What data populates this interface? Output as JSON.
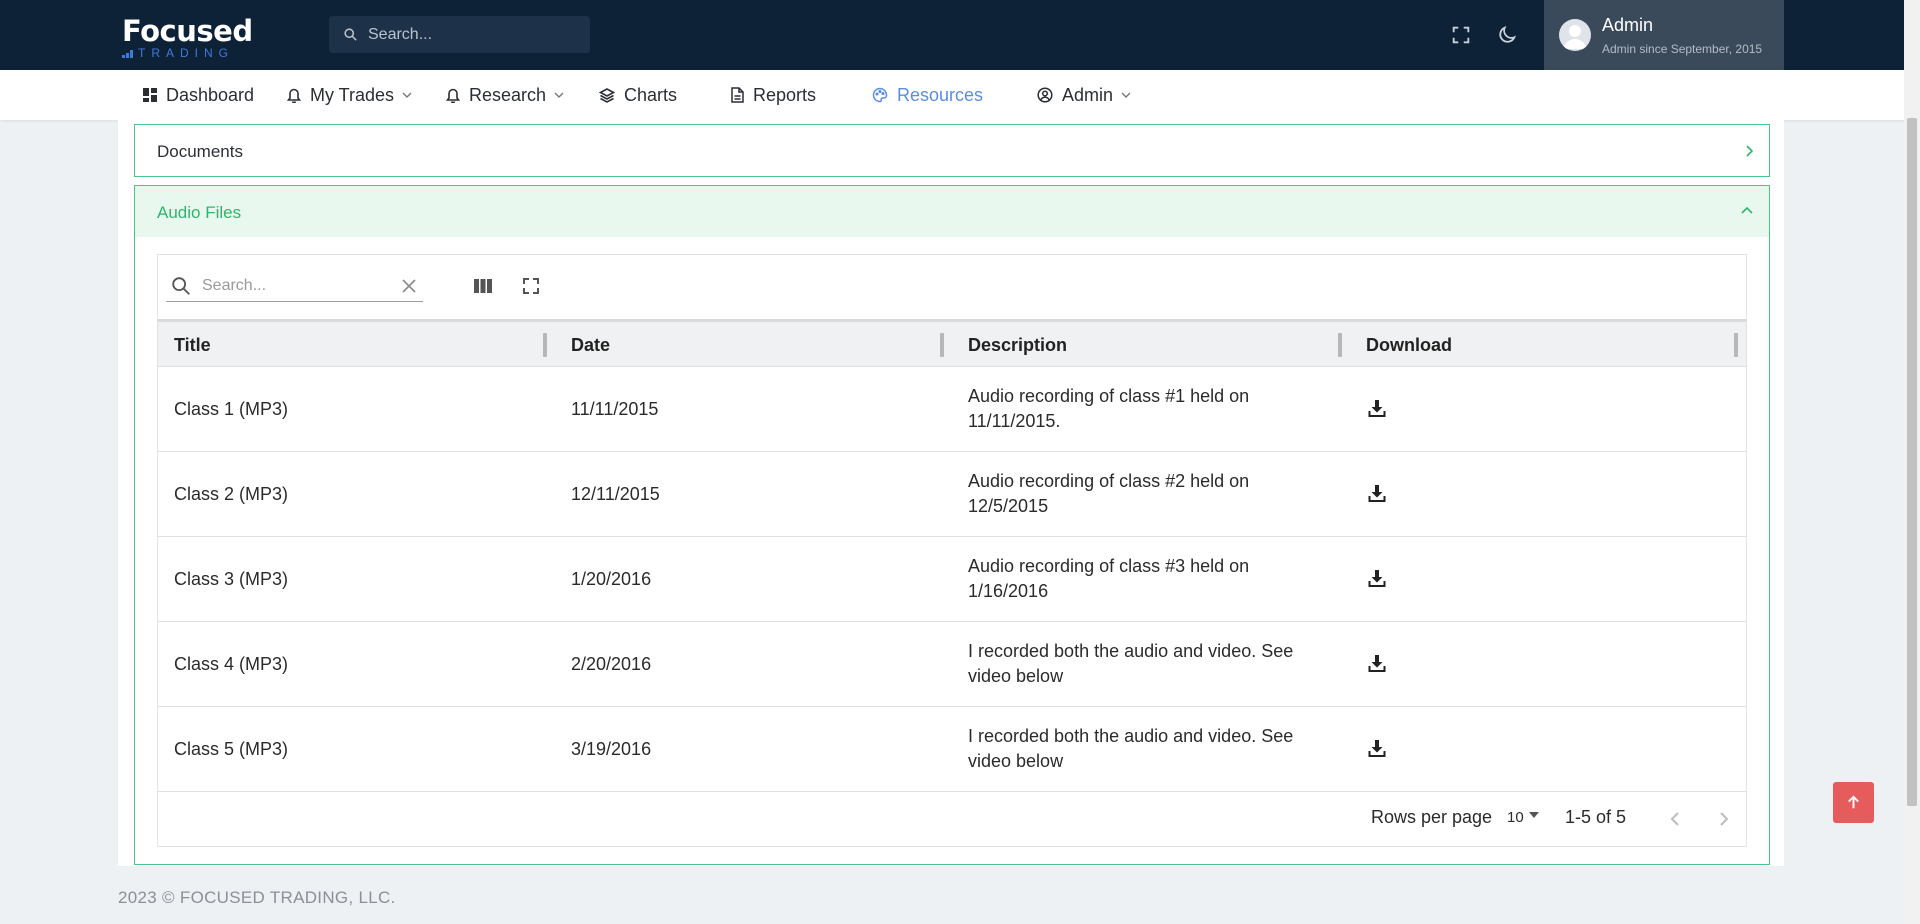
{
  "brand": {
    "logo_main": "Focused",
    "logo_sub": "TRADING"
  },
  "topbar": {
    "search_placeholder": "Search...",
    "icons": [
      "fullscreen-icon",
      "moon-icon"
    ],
    "user": {
      "name": "Admin",
      "subtitle": "Admin since September, 2015"
    }
  },
  "nav": {
    "items": [
      {
        "label": "Dashboard",
        "icon": "dashboard-icon",
        "dropdown": false
      },
      {
        "label": "My Trades",
        "icon": "bell-icon",
        "dropdown": true
      },
      {
        "label": "Research",
        "icon": "bell-icon",
        "dropdown": true
      },
      {
        "label": "Charts",
        "icon": "layers-icon",
        "dropdown": false
      },
      {
        "label": "Reports",
        "icon": "document-icon",
        "dropdown": false
      },
      {
        "label": "Resources",
        "icon": "palette-icon",
        "dropdown": false,
        "active": true
      },
      {
        "label": "Admin",
        "icon": "user-circle-icon",
        "dropdown": true
      }
    ],
    "active_color": "#5b8de0"
  },
  "accordions": {
    "documents": {
      "title": "Documents",
      "expanded": false
    },
    "audio": {
      "title": "Audio Files",
      "expanded": true
    }
  },
  "table": {
    "search_placeholder": "Search...",
    "columns": [
      "Title",
      "Date",
      "Description",
      "Download"
    ],
    "rows": [
      {
        "title": "Class 1 (MP3)",
        "date": "11/11/2015",
        "description": "Audio recording of class #1 held on 11/11/2015."
      },
      {
        "title": "Class 2 (MP3)",
        "date": "12/11/2015",
        "description": "Audio recording of class #2 held on 12/5/2015"
      },
      {
        "title": "Class 3 (MP3)",
        "date": "1/20/2016",
        "description": "Audio recording of class #3 held on 1/16/2016"
      },
      {
        "title": "Class 4 (MP3)",
        "date": "2/20/2016",
        "description": "I recorded both the audio and video. See video below"
      },
      {
        "title": "Class 5 (MP3)",
        "date": "3/19/2016",
        "description": "I recorded both the audio and video. See video below"
      }
    ],
    "rows_per_page_label": "Rows per page",
    "rows_per_page": "10",
    "page_info": "1-5 of 5"
  },
  "colors": {
    "topbar": "#0d2137",
    "accent_green": "#2fb56a",
    "scroll_top": "#e65c5c"
  },
  "footer": {
    "text": "2023 © FOCUSED TRADING, LLC."
  }
}
